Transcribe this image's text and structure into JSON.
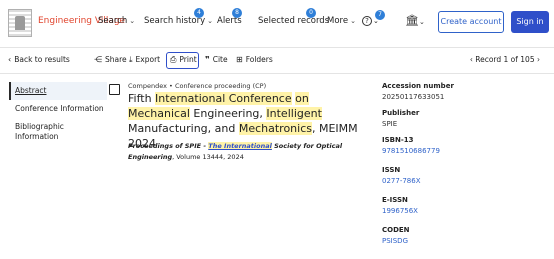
{
  "nav": {
    "brand": "Engineering Village",
    "items": [
      {
        "label": "Search",
        "badge": null
      },
      {
        "label": "Search history",
        "badge": "4"
      },
      {
        "label": "Alerts",
        "badge": "8"
      },
      {
        "label": "Selected records",
        "badge": "0"
      },
      {
        "label": "More",
        "badge": null
      }
    ],
    "help_badge": "7",
    "create_account": "Create account",
    "sign_in": "Sign in",
    "icons": {
      "help": "help-circle-icon",
      "institution": "institution-icon",
      "chevron": "chevron-down-icon"
    }
  },
  "toolbar": {
    "back": "Back to results",
    "share": "Share",
    "export": "Export",
    "print": "Print",
    "cite": "Cite",
    "folders": "Folders",
    "record_nav": "Record 1 of 105"
  },
  "sidebar": {
    "items": [
      {
        "label": "Abstract",
        "active": true
      },
      {
        "label": "Conference Information",
        "active": false
      },
      {
        "label": "Bibliographic Information",
        "active": false
      }
    ]
  },
  "record": {
    "source": "Compendex",
    "doc_type": "Conference proceeding (CP)",
    "title_parts": [
      {
        "text": "Fifth ",
        "hl": false
      },
      {
        "text": "International Conference",
        "hl": true
      },
      {
        "text": " ",
        "hl": false
      },
      {
        "text": "on Mechanical",
        "hl": true
      },
      {
        "text": " Engineering, ",
        "hl": false
      },
      {
        "text": "Intelligent",
        "hl": true
      },
      {
        "text": " Manufacturing, and ",
        "hl": false
      },
      {
        "text": "Mechatronics",
        "hl": true
      },
      {
        "text": ", MEIMM 2024",
        "hl": false
      }
    ],
    "journal_prefix": "Proceedings of SPIE - ",
    "journal_hl": "The International",
    "journal_suffix": " Society for Optical Engineering",
    "journal_tail": ", Volume 13444, 2024"
  },
  "details": {
    "accession_label": "Accession number",
    "accession_value": "20250117633051",
    "publisher_label": "Publisher",
    "publisher_value": "SPIE",
    "isbn_label": "ISBN-13",
    "isbn_value": "9781510686779",
    "issn_label": "ISSN",
    "issn_value": "0277-786X",
    "eissn_label": "E-ISSN",
    "eissn_value": "1996756X",
    "coden_label": "CODEN",
    "coden_value": "PSISDG"
  }
}
